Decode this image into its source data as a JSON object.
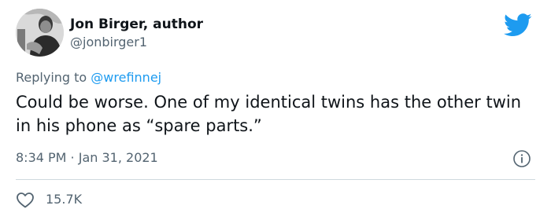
{
  "author": {
    "name": "Jon Birger, author",
    "handle": "@jonbirger1"
  },
  "reply": {
    "prefix": "Replying to",
    "mention": "@wrefinnej"
  },
  "tweet": {
    "text": "Could be worse. One of my identical twins has the other twin in his phone as “spare parts.”",
    "timestamp": "8:34 PM · Jan 31, 2021"
  },
  "stats": {
    "likes": "15.7K"
  },
  "icons": {
    "brand": "twitter-bird-icon",
    "info": "info-icon",
    "like": "heart-icon"
  },
  "colors": {
    "brand": "#1d9bf0",
    "text": "#0f1419",
    "muted": "#536471",
    "divider": "#cfd9de"
  }
}
